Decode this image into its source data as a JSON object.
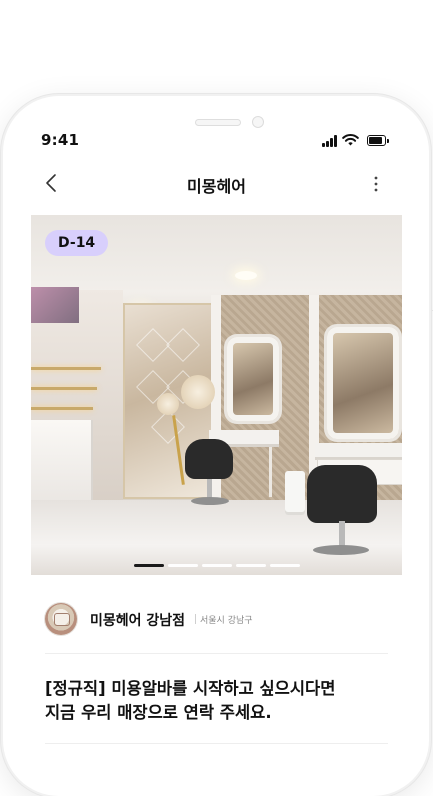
{
  "status_bar": {
    "time": "9:41"
  },
  "nav": {
    "title": "미몽헤어",
    "back_icon": "chevron-left-icon",
    "more_icon": "more-vertical-icon"
  },
  "hero": {
    "badge": "D-14",
    "image_description": "hair salon interior",
    "page_count": 5,
    "active_page": 1
  },
  "shop": {
    "name": "미몽헤어 강남점",
    "location": "서울시 강남구"
  },
  "post": {
    "title_line1": "[정규직] 미용알바를 시작하고 싶으시다면",
    "title_line2": "지금 우리 매장으로 연락 주세요."
  },
  "colors": {
    "badge_bg": "#d8cffc",
    "text_primary": "#111111",
    "text_secondary": "#888888",
    "pager_active": "#1a1a1a"
  }
}
